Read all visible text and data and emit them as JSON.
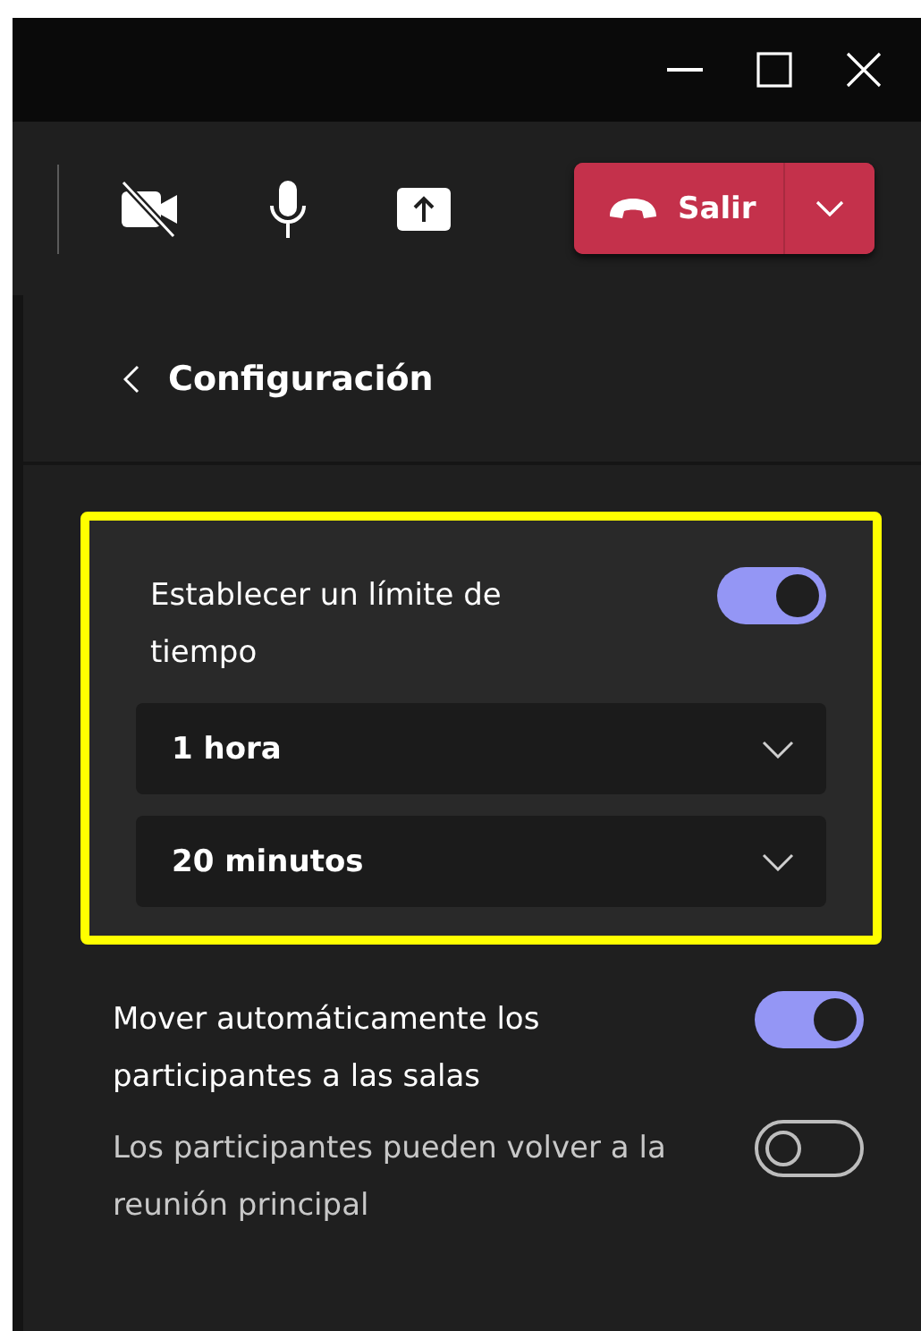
{
  "toolbar": {
    "leave_button": {
      "label": "Salir"
    }
  },
  "panel": {
    "title": "Configuración",
    "time_limit": {
      "label": "Establecer un límite de tiempo",
      "on": true,
      "highlighted": true,
      "dropdowns": [
        {
          "value": "1 hora"
        },
        {
          "value": "20 minutos"
        }
      ]
    },
    "options": [
      {
        "label": "Mover automáticamente los participantes a las salas",
        "on": true
      },
      {
        "label": "Los participantes pueden volver a la reunión principal",
        "on": false
      }
    ]
  }
}
